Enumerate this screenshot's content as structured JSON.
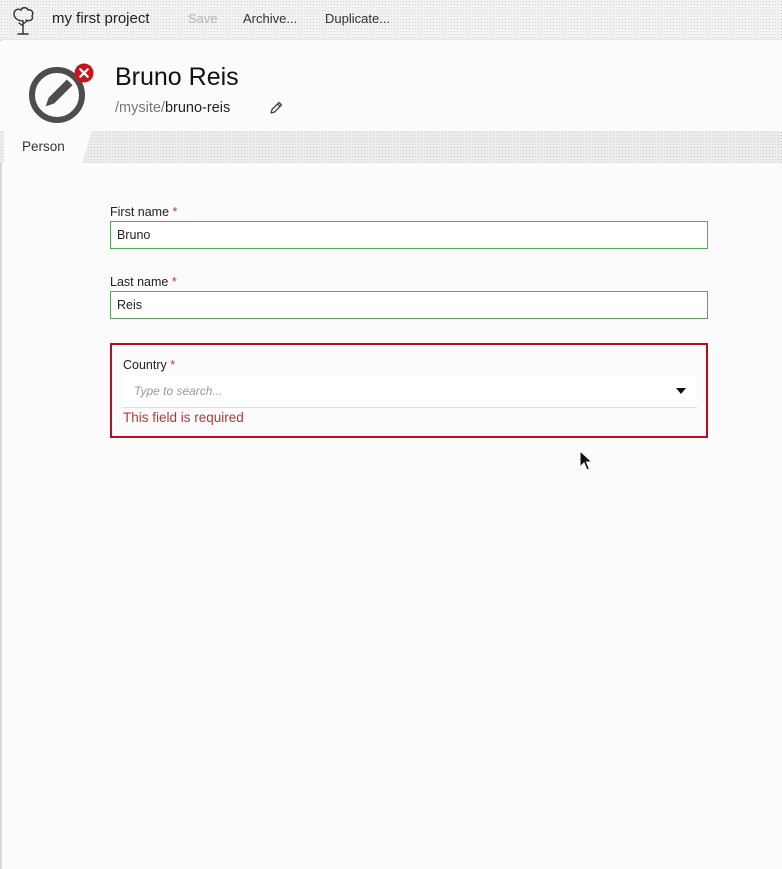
{
  "toolbar": {
    "logo_icon": "tree-icon",
    "project_title": "my first project",
    "save_label": "Save",
    "archive_label": "Archive...",
    "duplicate_label": "Duplicate..."
  },
  "header": {
    "avatar_icon": "pencil-icon",
    "error_badge_icon": "close-icon",
    "title": "Bruno Reis",
    "path_prefix": "/mysite/",
    "path_slug": "bruno-reis",
    "edit_slug_icon": "pencil-icon"
  },
  "tabs": [
    {
      "label": "Person"
    }
  ],
  "form": {
    "first_name": {
      "label": "First name",
      "required_mark": "*",
      "value": "Bruno"
    },
    "last_name": {
      "label": "Last name",
      "required_mark": "*",
      "value": "Reis"
    },
    "country": {
      "label": "Country",
      "required_mark": "*",
      "placeholder": "Type to search...",
      "error": "This field is required",
      "dropdown_icon": "caret-down-icon"
    }
  },
  "colors": {
    "valid_border": "#57a757",
    "error_border": "#b50f1c",
    "error_text": "#b03a3a",
    "badge_red": "#c4161c",
    "avatar_gray": "#4d4d4d"
  }
}
